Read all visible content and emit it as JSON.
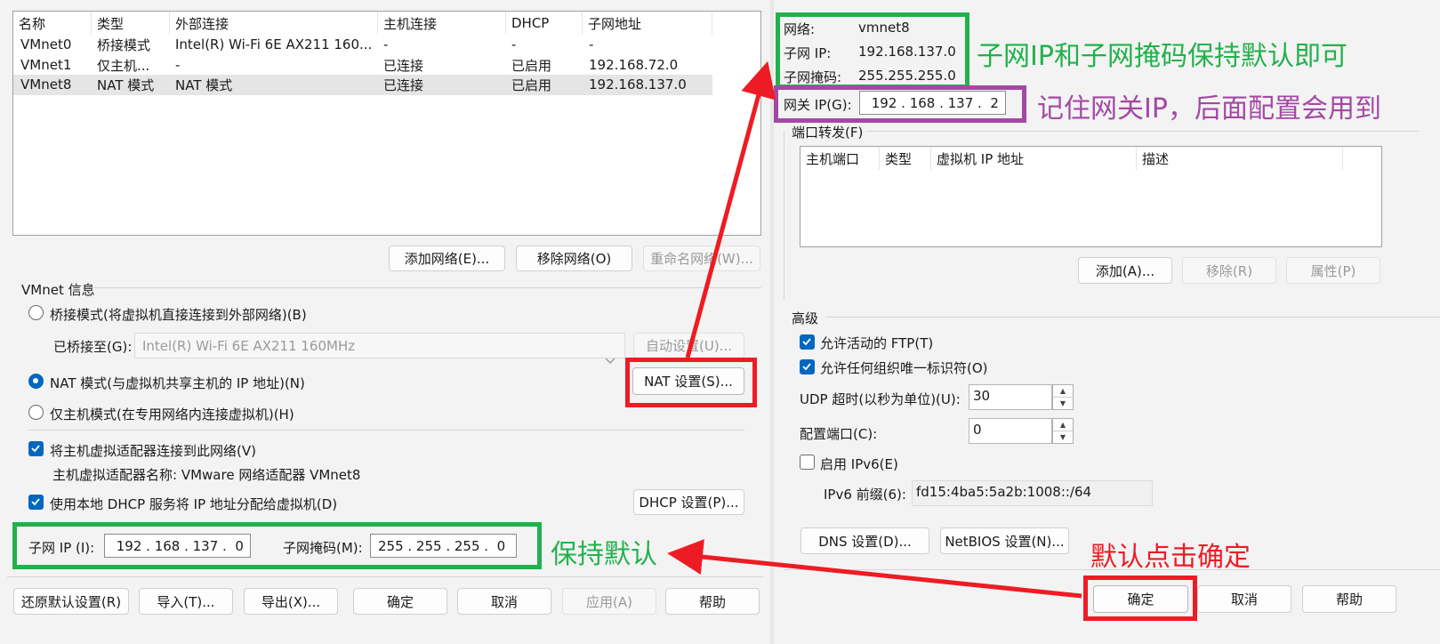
{
  "left": {
    "table": {
      "headers": [
        "名称",
        "类型",
        "外部连接",
        "主机连接",
        "DHCP",
        "子网地址"
      ],
      "rows": [
        [
          "VMnet0",
          "桥接模式",
          "Intel(R) Wi-Fi 6E AX211 160...",
          "-",
          "-",
          "-"
        ],
        [
          "VMnet1",
          "仅主机...",
          "-",
          "已连接",
          "已启用",
          "192.168.72.0"
        ],
        [
          "VMnet8",
          "NAT 模式",
          "NAT 模式",
          "已连接",
          "已启用",
          "192.168.137.0"
        ]
      ]
    },
    "buttons": {
      "add_network": "添加网络(E)...",
      "remove_network": "移除网络(O)",
      "rename_network": "重命名网络(W)..."
    },
    "vmnet_info": {
      "title": "VMnet 信息",
      "bridge_mode": "桥接模式(将虚拟机直接连接到外部网络)(B)",
      "bridged_to_label": "已桥接至(G):",
      "bridged_to_value": "Intel(R) Wi-Fi 6E AX211 160MHz",
      "auto_settings": "自动设置(U)...",
      "nat_mode": "NAT 模式(与虚拟机共享主机的 IP 地址)(N)",
      "nat_settings": "NAT 设置(S)...",
      "host_only_mode": "仅主机模式(在专用网络内连接虚拟机)(H)",
      "connect_adapter": "将主机虚拟适配器连接到此网络(V)",
      "adapter_name": "主机虚拟适配器名称: VMware 网络适配器 VMnet8",
      "use_dhcp": "使用本地 DHCP 服务将 IP 地址分配给虚拟机(D)",
      "dhcp_settings": "DHCP 设置(P)...",
      "subnet_ip_label": "子网 IP (I):",
      "subnet_ip_value": " 192 . 168 . 137 .  0",
      "subnet_mask_label": "子网掩码(M):",
      "subnet_mask_value": "255 . 255 . 255 .  0"
    },
    "footer": {
      "restore_defaults": "还原默认设置(R)",
      "import": "导入(T)...",
      "export": "导出(X)...",
      "ok": "确定",
      "cancel": "取消",
      "apply": "应用(A)",
      "help": "帮助"
    }
  },
  "right": {
    "network_label": "网络:",
    "network_value": "vmnet8",
    "subnet_ip_label": "子网 IP:",
    "subnet_ip_value": "192.168.137.0",
    "subnet_mask_label": "子网掩码:",
    "subnet_mask_value": "255.255.255.0",
    "gateway_label": "网关 IP(G):",
    "gateway_value": " 192 . 168 . 137 .  2",
    "port_forwarding": {
      "title": "端口转发(F)",
      "headers": [
        "主机端口",
        "类型",
        "虚拟机 IP 地址",
        "描述"
      ],
      "add": "添加(A)...",
      "remove": "移除(R)",
      "properties": "属性(P)"
    },
    "advanced": {
      "title": "高级",
      "allow_ftp": "允许活动的 FTP(T)",
      "allow_oui": "允许任何组织唯一标识符(O)",
      "udp_timeout_label": "UDP 超时(以秒为单位)(U):",
      "udp_timeout_value": "30",
      "config_port_label": "配置端口(C):",
      "config_port_value": "0",
      "enable_ipv6": "启用 IPv6(E)",
      "ipv6_prefix_label": "IPv6 前缀(6):",
      "ipv6_prefix_value": "fd15:4ba5:5a2b:1008::/64"
    },
    "buttons": {
      "dns": "DNS 设置(D)...",
      "netbios": "NetBIOS 设置(N)...",
      "ok": "确定",
      "cancel": "取消",
      "help": "帮助"
    }
  },
  "annotations": {
    "subnet_keep_default": "子网IP和子网掩码保持默认即可",
    "remember_gateway": "记住网关IP，后面配置会用到",
    "keep_default": "保持默认",
    "default_click_ok": "默认点击确定"
  },
  "colors": {
    "green": "#22b14c",
    "purple": "#a349a4",
    "red": "#ed1c24",
    "accent": "#0067c0"
  }
}
